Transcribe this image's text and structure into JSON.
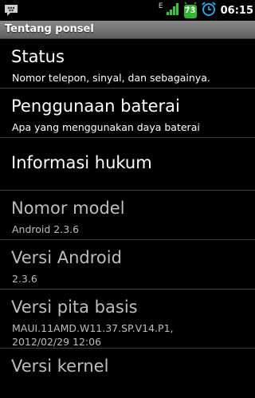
{
  "status_bar": {
    "network": "E",
    "battery_level": "73",
    "time": "06:15",
    "icons": [
      "bbm-icon",
      "signal-icon",
      "battery-icon",
      "alarm-icon"
    ]
  },
  "header": {
    "title": "Tentang ponsel"
  },
  "items": [
    {
      "title": "Status",
      "subtitle": "Nomor telepon, sinyal, dan sebagainya."
    },
    {
      "title": "Penggunaan baterai",
      "subtitle": "Apa yang menggunakan daya baterai"
    },
    {
      "title": "Informasi hukum"
    },
    {
      "title": "Nomor model",
      "subtitle": "Android 2.3.6"
    },
    {
      "title": "Versi Android",
      "subtitle": "2.3.6"
    },
    {
      "title": "Versi pita basis",
      "subtitle_line1": "MAUI.11AMD.W11.37.SP.V14.P1,",
      "subtitle_line2": "2012/02/29 12:06"
    },
    {
      "title": "Versi kernel"
    }
  ],
  "colors": {
    "title_bar": "#6e6e6e",
    "battery_green": "#2fb82f",
    "alarm_blue": "#2aa3e6",
    "signal_green": "#33cc33",
    "divider": "#404040",
    "dim_text": "#bdbdbd"
  }
}
